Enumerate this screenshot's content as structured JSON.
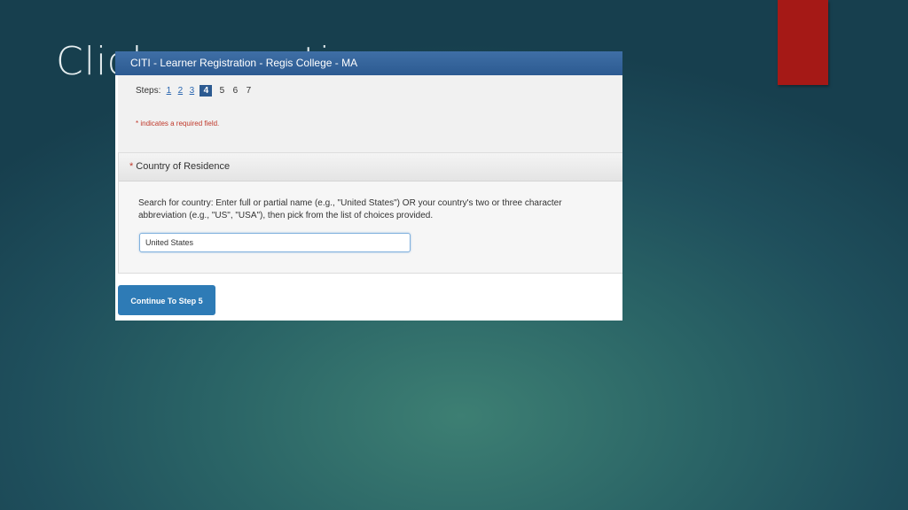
{
  "slide": {
    "title": "Click on continue"
  },
  "window": {
    "title": "CITI - Learner Registration - Regis College - MA"
  },
  "steps": {
    "label": "Steps:",
    "items": [
      {
        "label": "1",
        "state": "done"
      },
      {
        "label": "2",
        "state": "done"
      },
      {
        "label": "3",
        "state": "done"
      },
      {
        "label": "4",
        "state": "current"
      },
      {
        "label": "5",
        "state": "todo"
      },
      {
        "label": "6",
        "state": "todo"
      },
      {
        "label": "7",
        "state": "todo"
      }
    ],
    "required_note": "* indicates a required field."
  },
  "country_section": {
    "required_marker": "*",
    "heading": "Country of Residence",
    "help_text": "Search for country: Enter full or partial name (e.g., \"United States\") OR your country's two or three character abbreviation (e.g., \"US\", \"USA\"), then pick from the list of choices provided.",
    "input_value": "United States"
  },
  "continue_button": {
    "label": "Continue To Step 5"
  },
  "colors": {
    "header_blue": "#2c5a91",
    "button_blue": "#2e7bb6",
    "accent_red": "#a51916"
  }
}
